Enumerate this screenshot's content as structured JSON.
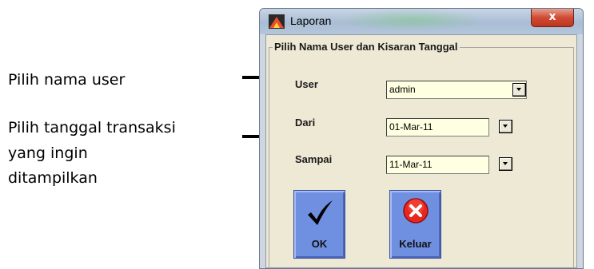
{
  "callouts": {
    "user": "Pilih nama user",
    "date_line1": "Pilih tanggal transaksi",
    "date_line2": "yang ingin",
    "date_line3": "ditampilkan"
  },
  "window": {
    "title": "Laporan",
    "close_glyph": "x",
    "group_title": "Pilih Nama User dan Kisaran Tanggal"
  },
  "form": {
    "user_label": "User",
    "user_value": "admin",
    "dari_label": "Dari",
    "dari_value": "01-Mar-11",
    "sampai_label": "Sampai",
    "sampai_value": "11-Mar-11"
  },
  "buttons": {
    "ok_label": "OK",
    "keluar_label": "Keluar"
  },
  "icons": {
    "app": "report-app-icon",
    "ok": "checkmark-icon",
    "keluar": "red-x-icon",
    "dropdown": "chevron-down-icon"
  },
  "colors": {
    "button_blue": "#6f8fe0",
    "field_yellow": "#ffffe1",
    "panel_bg": "#ede9d5",
    "close_red": "#cf4b34"
  }
}
